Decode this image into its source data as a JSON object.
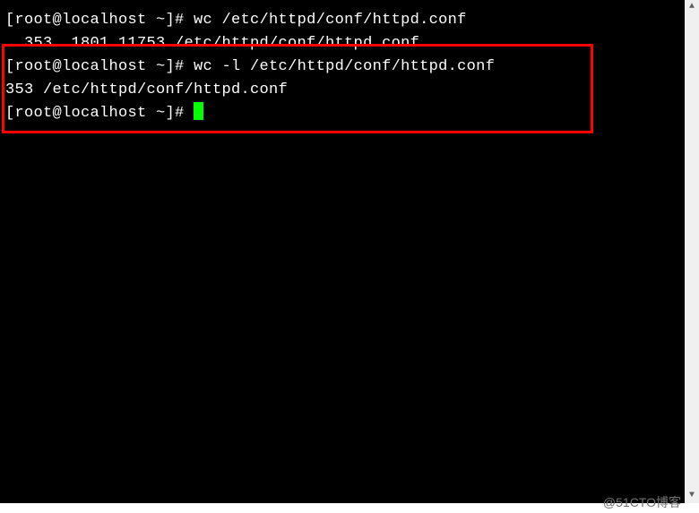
{
  "terminal": {
    "lines": [
      {
        "prompt": "[root@localhost ~]# ",
        "command": "wc /etc/httpd/conf/httpd.conf"
      },
      {
        "output": "  353  1801 11753 /etc/httpd/conf/httpd.conf"
      },
      {
        "prompt": "[root@localhost ~]# ",
        "command": "wc -l /etc/httpd/conf/httpd.conf"
      },
      {
        "output": "353 /etc/httpd/conf/httpd.conf"
      },
      {
        "prompt": "[root@localhost ~]# ",
        "cursor": true
      }
    ]
  },
  "watermark": "@51CTO博客",
  "scroll": {
    "up": "▲",
    "down": "▼"
  }
}
